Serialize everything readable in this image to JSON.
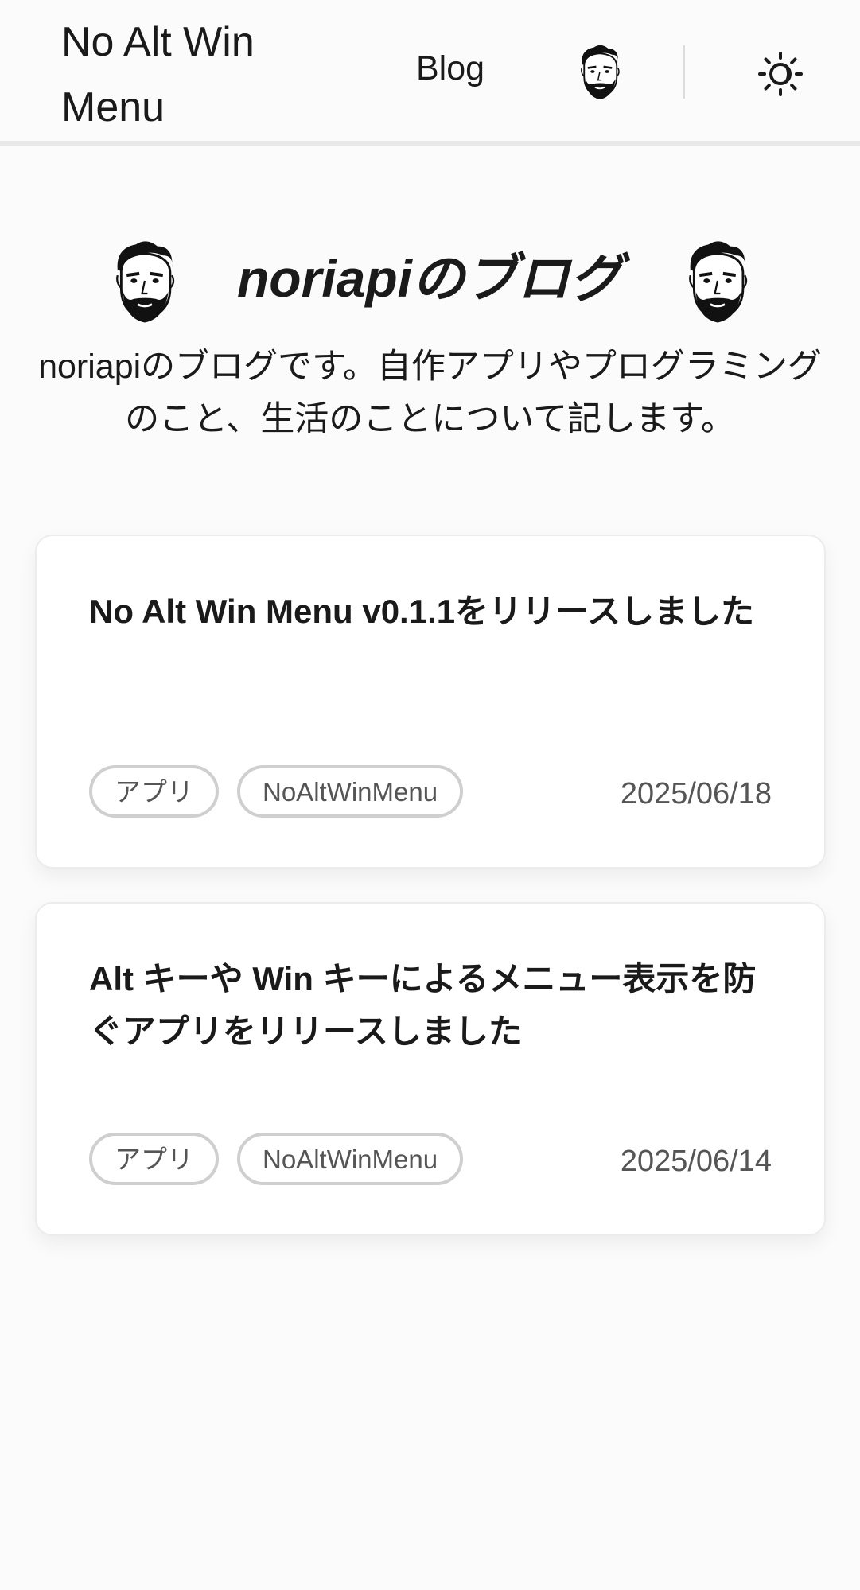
{
  "header": {
    "site_title": "No Alt Win Menu",
    "nav_blog": "Blog"
  },
  "hero": {
    "title": "noriapiのブログ",
    "description": "noriapiのブログです。自作アプリやプログラミングのこと、生活のことについて記します。"
  },
  "posts": [
    {
      "title": "No Alt Win Menu v0.1.1をリリースしました",
      "tags": [
        "アプリ",
        "NoAltWinMenu"
      ],
      "date": "2025/06/18"
    },
    {
      "title": "Alt キーや Win キーによるメニュー表示を防ぐアプリをリリースしました",
      "tags": [
        "アプリ",
        "NoAltWinMenu"
      ],
      "date": "2025/06/14"
    }
  ],
  "icons": {
    "theme_toggle": "sun-moon-icon",
    "avatar": "avatar-face-icon"
  }
}
